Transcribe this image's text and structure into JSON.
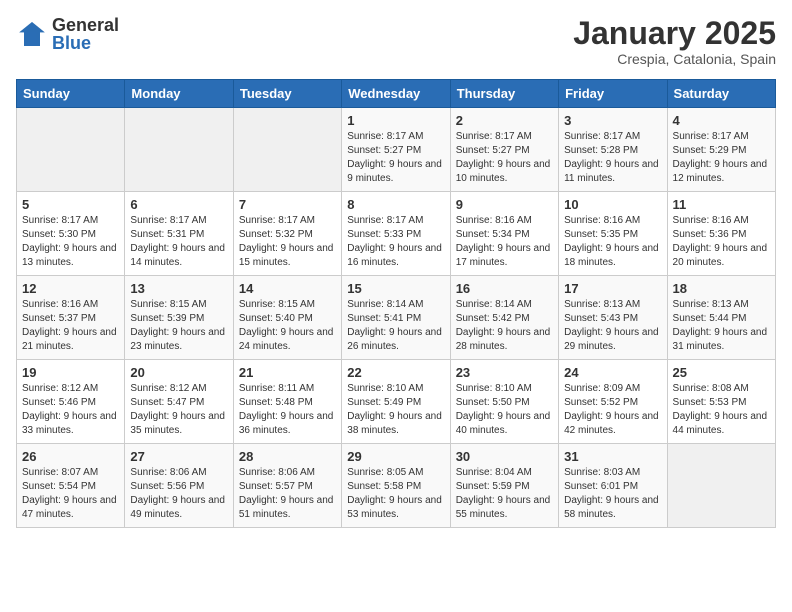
{
  "logo": {
    "general": "General",
    "blue": "Blue"
  },
  "header": {
    "month": "January 2025",
    "location": "Crespia, Catalonia, Spain"
  },
  "weekdays": [
    "Sunday",
    "Monday",
    "Tuesday",
    "Wednesday",
    "Thursday",
    "Friday",
    "Saturday"
  ],
  "weeks": [
    [
      {
        "day": "",
        "sunrise": "",
        "sunset": "",
        "daylight": ""
      },
      {
        "day": "",
        "sunrise": "",
        "sunset": "",
        "daylight": ""
      },
      {
        "day": "",
        "sunrise": "",
        "sunset": "",
        "daylight": ""
      },
      {
        "day": "1",
        "sunrise": "Sunrise: 8:17 AM",
        "sunset": "Sunset: 5:27 PM",
        "daylight": "Daylight: 9 hours and 9 minutes."
      },
      {
        "day": "2",
        "sunrise": "Sunrise: 8:17 AM",
        "sunset": "Sunset: 5:27 PM",
        "daylight": "Daylight: 9 hours and 10 minutes."
      },
      {
        "day": "3",
        "sunrise": "Sunrise: 8:17 AM",
        "sunset": "Sunset: 5:28 PM",
        "daylight": "Daylight: 9 hours and 11 minutes."
      },
      {
        "day": "4",
        "sunrise": "Sunrise: 8:17 AM",
        "sunset": "Sunset: 5:29 PM",
        "daylight": "Daylight: 9 hours and 12 minutes."
      }
    ],
    [
      {
        "day": "5",
        "sunrise": "Sunrise: 8:17 AM",
        "sunset": "Sunset: 5:30 PM",
        "daylight": "Daylight: 9 hours and 13 minutes."
      },
      {
        "day": "6",
        "sunrise": "Sunrise: 8:17 AM",
        "sunset": "Sunset: 5:31 PM",
        "daylight": "Daylight: 9 hours and 14 minutes."
      },
      {
        "day": "7",
        "sunrise": "Sunrise: 8:17 AM",
        "sunset": "Sunset: 5:32 PM",
        "daylight": "Daylight: 9 hours and 15 minutes."
      },
      {
        "day": "8",
        "sunrise": "Sunrise: 8:17 AM",
        "sunset": "Sunset: 5:33 PM",
        "daylight": "Daylight: 9 hours and 16 minutes."
      },
      {
        "day": "9",
        "sunrise": "Sunrise: 8:16 AM",
        "sunset": "Sunset: 5:34 PM",
        "daylight": "Daylight: 9 hours and 17 minutes."
      },
      {
        "day": "10",
        "sunrise": "Sunrise: 8:16 AM",
        "sunset": "Sunset: 5:35 PM",
        "daylight": "Daylight: 9 hours and 18 minutes."
      },
      {
        "day": "11",
        "sunrise": "Sunrise: 8:16 AM",
        "sunset": "Sunset: 5:36 PM",
        "daylight": "Daylight: 9 hours and 20 minutes."
      }
    ],
    [
      {
        "day": "12",
        "sunrise": "Sunrise: 8:16 AM",
        "sunset": "Sunset: 5:37 PM",
        "daylight": "Daylight: 9 hours and 21 minutes."
      },
      {
        "day": "13",
        "sunrise": "Sunrise: 8:15 AM",
        "sunset": "Sunset: 5:39 PM",
        "daylight": "Daylight: 9 hours and 23 minutes."
      },
      {
        "day": "14",
        "sunrise": "Sunrise: 8:15 AM",
        "sunset": "Sunset: 5:40 PM",
        "daylight": "Daylight: 9 hours and 24 minutes."
      },
      {
        "day": "15",
        "sunrise": "Sunrise: 8:14 AM",
        "sunset": "Sunset: 5:41 PM",
        "daylight": "Daylight: 9 hours and 26 minutes."
      },
      {
        "day": "16",
        "sunrise": "Sunrise: 8:14 AM",
        "sunset": "Sunset: 5:42 PM",
        "daylight": "Daylight: 9 hours and 28 minutes."
      },
      {
        "day": "17",
        "sunrise": "Sunrise: 8:13 AM",
        "sunset": "Sunset: 5:43 PM",
        "daylight": "Daylight: 9 hours and 29 minutes."
      },
      {
        "day": "18",
        "sunrise": "Sunrise: 8:13 AM",
        "sunset": "Sunset: 5:44 PM",
        "daylight": "Daylight: 9 hours and 31 minutes."
      }
    ],
    [
      {
        "day": "19",
        "sunrise": "Sunrise: 8:12 AM",
        "sunset": "Sunset: 5:46 PM",
        "daylight": "Daylight: 9 hours and 33 minutes."
      },
      {
        "day": "20",
        "sunrise": "Sunrise: 8:12 AM",
        "sunset": "Sunset: 5:47 PM",
        "daylight": "Daylight: 9 hours and 35 minutes."
      },
      {
        "day": "21",
        "sunrise": "Sunrise: 8:11 AM",
        "sunset": "Sunset: 5:48 PM",
        "daylight": "Daylight: 9 hours and 36 minutes."
      },
      {
        "day": "22",
        "sunrise": "Sunrise: 8:10 AM",
        "sunset": "Sunset: 5:49 PM",
        "daylight": "Daylight: 9 hours and 38 minutes."
      },
      {
        "day": "23",
        "sunrise": "Sunrise: 8:10 AM",
        "sunset": "Sunset: 5:50 PM",
        "daylight": "Daylight: 9 hours and 40 minutes."
      },
      {
        "day": "24",
        "sunrise": "Sunrise: 8:09 AM",
        "sunset": "Sunset: 5:52 PM",
        "daylight": "Daylight: 9 hours and 42 minutes."
      },
      {
        "day": "25",
        "sunrise": "Sunrise: 8:08 AM",
        "sunset": "Sunset: 5:53 PM",
        "daylight": "Daylight: 9 hours and 44 minutes."
      }
    ],
    [
      {
        "day": "26",
        "sunrise": "Sunrise: 8:07 AM",
        "sunset": "Sunset: 5:54 PM",
        "daylight": "Daylight: 9 hours and 47 minutes."
      },
      {
        "day": "27",
        "sunrise": "Sunrise: 8:06 AM",
        "sunset": "Sunset: 5:56 PM",
        "daylight": "Daylight: 9 hours and 49 minutes."
      },
      {
        "day": "28",
        "sunrise": "Sunrise: 8:06 AM",
        "sunset": "Sunset: 5:57 PM",
        "daylight": "Daylight: 9 hours and 51 minutes."
      },
      {
        "day": "29",
        "sunrise": "Sunrise: 8:05 AM",
        "sunset": "Sunset: 5:58 PM",
        "daylight": "Daylight: 9 hours and 53 minutes."
      },
      {
        "day": "30",
        "sunrise": "Sunrise: 8:04 AM",
        "sunset": "Sunset: 5:59 PM",
        "daylight": "Daylight: 9 hours and 55 minutes."
      },
      {
        "day": "31",
        "sunrise": "Sunrise: 8:03 AM",
        "sunset": "Sunset: 6:01 PM",
        "daylight": "Daylight: 9 hours and 58 minutes."
      },
      {
        "day": "",
        "sunrise": "",
        "sunset": "",
        "daylight": ""
      }
    ]
  ]
}
